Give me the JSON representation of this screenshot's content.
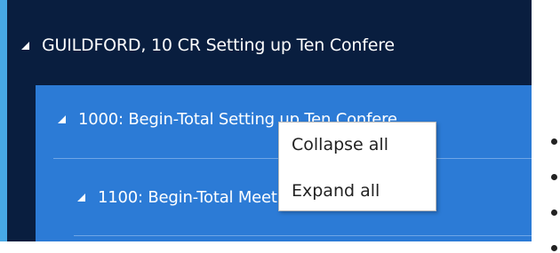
{
  "tree": {
    "root": {
      "label": "GUILDFORD, 10 CR Setting up Ten Confere"
    },
    "child": {
      "label": "1000: Begin-Total Setting up Ten Confere"
    },
    "grandchild": {
      "label": "1100: Begin-Total Meeting Services"
    }
  },
  "context_menu": {
    "items": [
      {
        "label": "Collapse all"
      },
      {
        "label": "Expand all"
      }
    ]
  },
  "colors": {
    "panel_dark": "#091e3f",
    "selection_blue": "#2c7bd6",
    "accent_strip": "#47a8e5"
  },
  "icons": {
    "expand_indicator": "caret-down-right-icon",
    "list_marker": "bullet-dot-icon"
  }
}
